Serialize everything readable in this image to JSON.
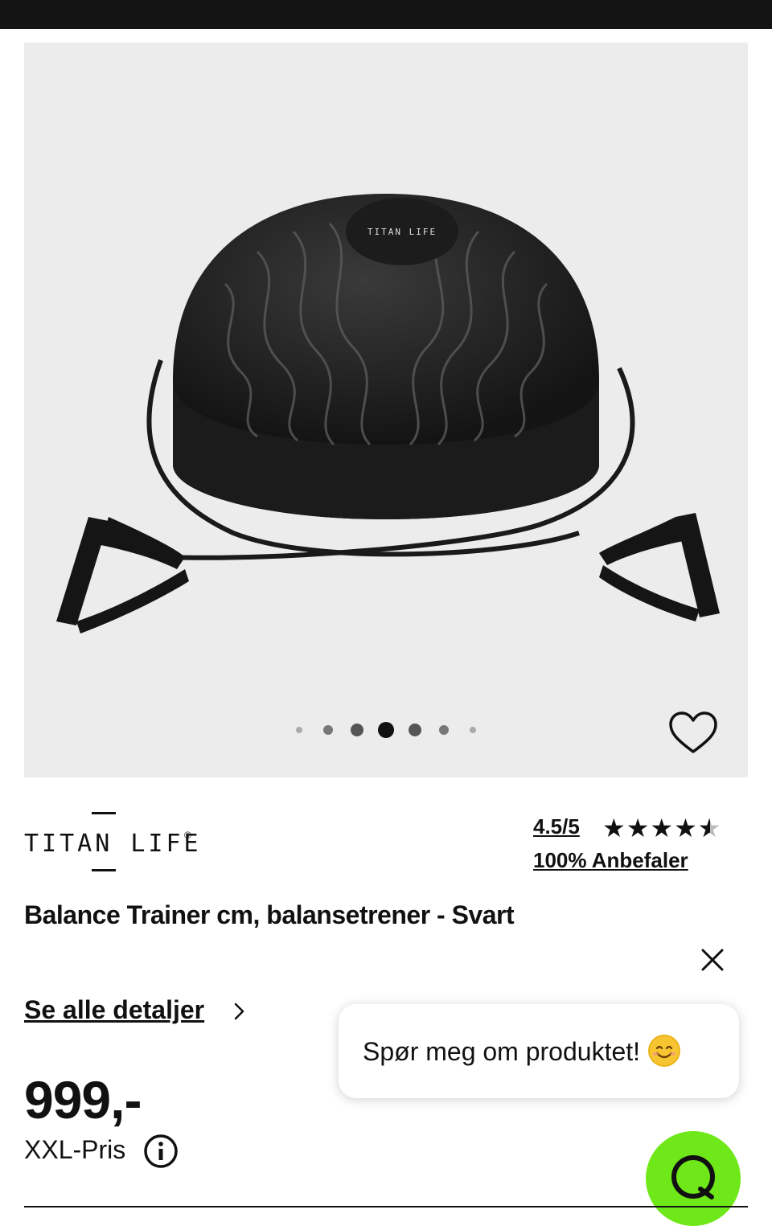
{
  "gallery": {
    "image_alt": "Balance Trainer",
    "product_logo_text": "TITAN LIFE",
    "dot_count": 7,
    "active_dot": 3
  },
  "brand": {
    "name": "TITAN LIFE",
    "registered_mark": "®"
  },
  "rating": {
    "score": "4.5/5",
    "stars_value": 4.5,
    "stars_max": 5,
    "recommend": "100% Anbefaler"
  },
  "product": {
    "title": "Balance Trainer cm, balansetrener - Svart",
    "details_link": "Se alle detaljer",
    "price": "999,-",
    "price_label": "XXL-Pris"
  },
  "chat": {
    "prompt": "Spør meg om produktet!",
    "fab_icon": "chat-q-icon",
    "fab_color": "#6ee818"
  },
  "icons": {
    "favorite": "heart-icon",
    "close": "close-icon",
    "info": "info-icon",
    "chevron": "chevron-right-icon"
  }
}
